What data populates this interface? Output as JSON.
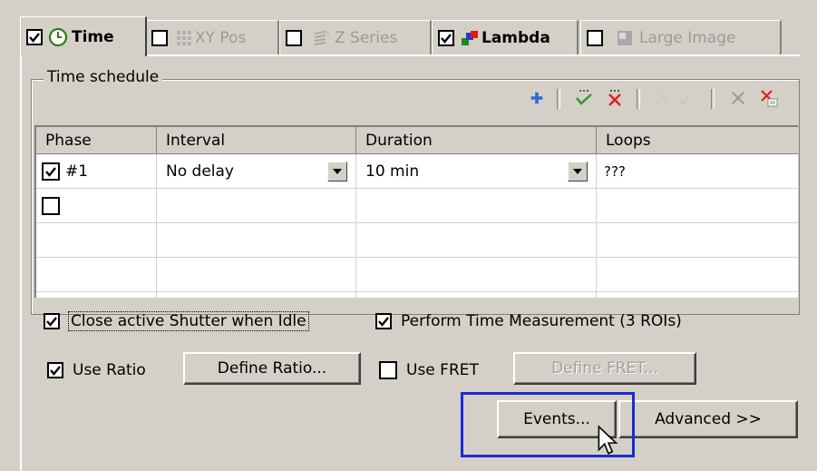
{
  "tabs": [
    {
      "label": "Time",
      "checked": true,
      "icon": "clock-icon",
      "active": true
    },
    {
      "label": "XY Pos",
      "checked": false,
      "icon": "grid-icon",
      "disabled": true
    },
    {
      "label": "Z Series",
      "checked": false,
      "icon": "z-stack-icon",
      "disabled": true
    },
    {
      "label": "Lambda",
      "checked": true,
      "icon": "lambda-icon",
      "bold": true
    },
    {
      "label": "Large Image",
      "checked": false,
      "icon": "large-image-icon",
      "disabled": true
    }
  ],
  "group": {
    "title": "Time schedule"
  },
  "toolbar": [
    "add-icon",
    "check-all-icon",
    "uncheck-all-icon",
    "move-up-icon",
    "move-down-icon",
    "delete-icon",
    "delete-all-icon"
  ],
  "table": {
    "columns": [
      "Phase",
      "Interval",
      "Duration",
      "Loops"
    ],
    "rows": [
      {
        "checked": true,
        "phase": "#1",
        "interval": "No delay",
        "duration": "10 min",
        "loops": "???"
      },
      {
        "checked": false,
        "phase": "",
        "interval": "",
        "duration": "",
        "loops": ""
      }
    ]
  },
  "options": {
    "close_shutter": {
      "label": "Close active Shutter when Idle",
      "checked": true
    },
    "time_measurement": {
      "label": "Perform Time Measurement (3 ROIs)",
      "checked": true
    },
    "use_ratio": {
      "label": "Use Ratio",
      "checked": true
    },
    "use_fret": {
      "label": "Use FRET",
      "checked": false
    }
  },
  "buttons": {
    "define_ratio": "Define Ratio...",
    "define_fret": "Define FRET...",
    "events": "Events...",
    "advanced": "Advanced >>"
  },
  "colors": {
    "highlight_box": "#1a2bd6",
    "face": "#d4d0c8"
  }
}
